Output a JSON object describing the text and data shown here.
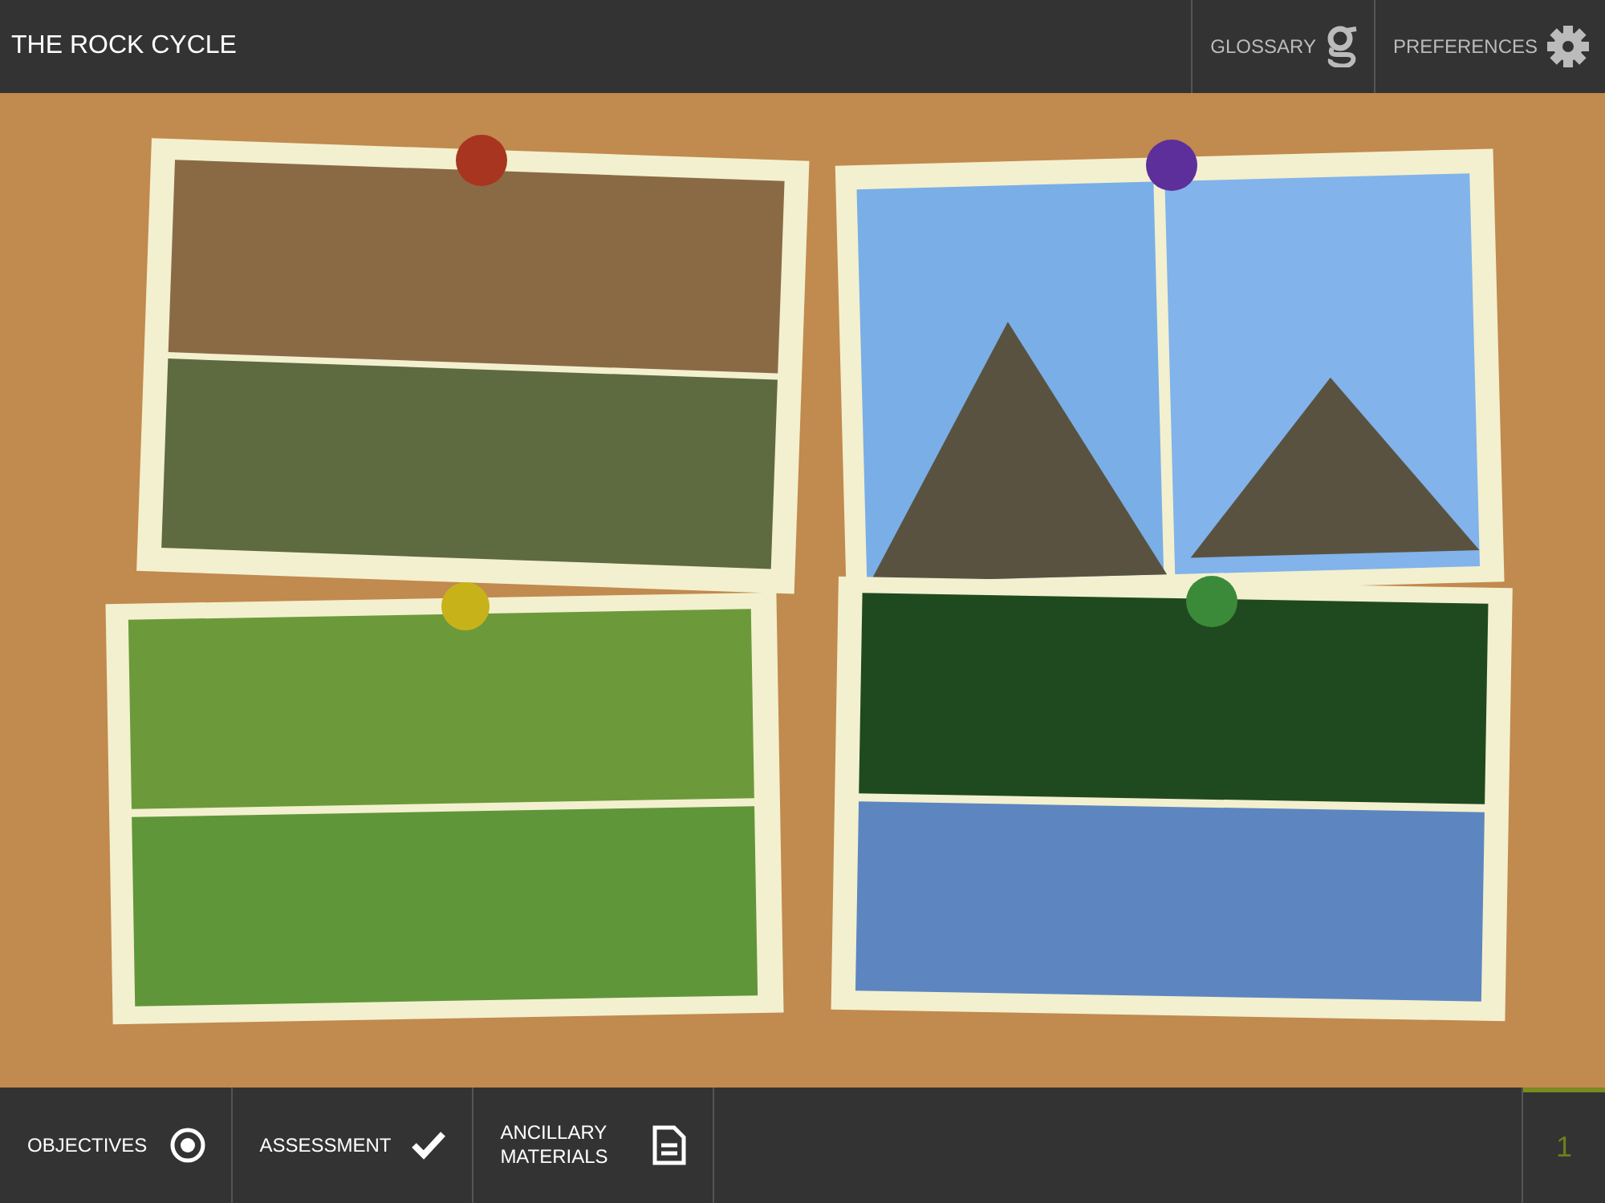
{
  "header": {
    "title": "THE ROCK CYCLE",
    "buttons": [
      {
        "label": "GLOSSARY",
        "kind": "glossary"
      },
      {
        "label": "PREFERENCES",
        "kind": "settings"
      }
    ]
  },
  "footer": {
    "buttons": [
      {
        "label": "OBJECTIVES",
        "kind": "target"
      },
      {
        "label": "ASSESSMENT",
        "kind": "check"
      },
      {
        "label": "ANCILLARY MATERIALS",
        "kind": "document"
      }
    ],
    "page": "1"
  }
}
